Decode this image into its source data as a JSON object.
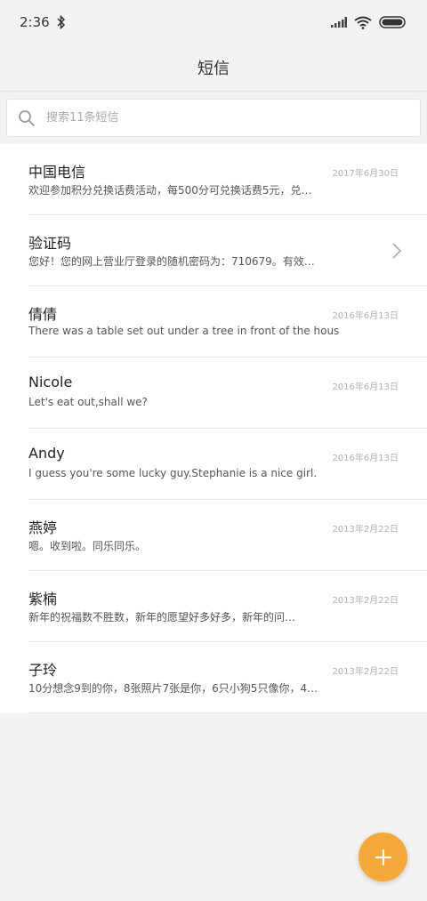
{
  "status_bar": {
    "time": "2:36",
    "icons": [
      "bluetooth-icon",
      "signal-icon",
      "wifi-icon",
      "battery-icon"
    ]
  },
  "header": {
    "title": "短信"
  },
  "search": {
    "placeholder": "搜索11条短信",
    "value": ""
  },
  "conversations": [
    {
      "name": "中国电信",
      "date": "2017年6月30日",
      "preview": "欢迎参加积分兑换话费活动，每500分可兑换话费5元，兑…",
      "has_chevron": false
    },
    {
      "name": "验证码",
      "date": "",
      "preview": "您好！您的网上营业厅登录的随机密码为：710679。有效…",
      "has_chevron": true
    },
    {
      "name": "倩倩",
      "date": "2016年6月13日",
      "preview": "There was a table set out under a tree in front of the hous",
      "has_chevron": false
    },
    {
      "name": "Nicole",
      "date": "2016年6月13日",
      "preview": "Let's eat out,shall we?",
      "has_chevron": false
    },
    {
      "name": "Andy",
      "date": "2016年6月13日",
      "preview": "I guess you're some lucky guy.Stephanie is a nice girl.",
      "has_chevron": false
    },
    {
      "name": "燕婷",
      "date": "2013年2月22日",
      "preview": "嗯。收到啦。同乐同乐。",
      "has_chevron": false
    },
    {
      "name": "紫楠",
      "date": "2013年2月22日",
      "preview": "新年的祝福数不胜数，新年的愿望好多好多，新年的问…",
      "has_chevron": false
    },
    {
      "name": "子玲",
      "date": "2013年2月22日",
      "preview": "10分想念9到的你，8张照片7张是你，6只小狗5只像你，4…",
      "has_chevron": false
    }
  ],
  "fab": {
    "icon": "plus-icon"
  },
  "colors": {
    "accent": "#f6a93b",
    "background": "#f3f3f3"
  }
}
